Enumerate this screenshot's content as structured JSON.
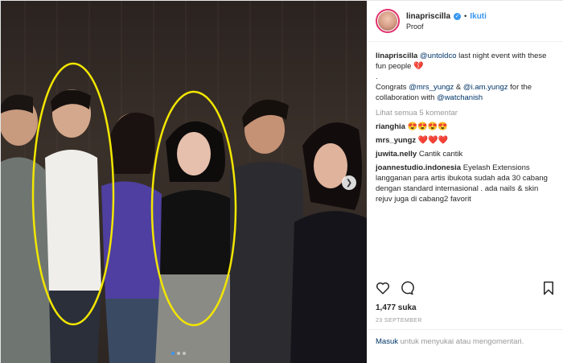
{
  "post": {
    "dots": [
      true,
      false,
      false
    ]
  },
  "header": {
    "username": "linapriscilla",
    "follow": "Ikuti",
    "location": "Proof",
    "verified_mark": "✓"
  },
  "caption": {
    "username": "linapriscilla",
    "mention1": "@untoldco",
    "text1": " last night event with these fun people ",
    "emoji1": "💔",
    "dot": ".",
    "congrats": "Congrats ",
    "mention2": "@mrs_yungz",
    "amp": " & ",
    "mention3": "@i.am.yungz",
    "text2": " for the collaboration with ",
    "mention4": "@watchanish"
  },
  "view_all": "Lihat semua 5 komentar",
  "comments": [
    {
      "user": "rianghia",
      "text": "😍😍😍😍"
    },
    {
      "user": "mrs_yungz",
      "text": "❤️❤️❤️"
    },
    {
      "user": "juwita.nelly",
      "text": "Cantik cantik"
    },
    {
      "user": "joannestudio.indonesia",
      "text": "Eyelash Extensions langganan para artis ibukota sudah ada 30 cabang dengan standard internasional . ada nails & skin rejuv juga di cabang2 favorit"
    }
  ],
  "likes": "1,477 suka",
  "date": "23 SEPTEMBER",
  "login": {
    "link": "Masuk",
    "text": " untuk menyukai atau mengomentari."
  },
  "icons": {
    "like": "heart-icon",
    "comment": "comment-icon",
    "save": "bookmark-icon",
    "next": "chevron-right-icon"
  },
  "colors": {
    "highlight": "#f2e600",
    "link": "#3897f0",
    "mention": "#003569"
  }
}
